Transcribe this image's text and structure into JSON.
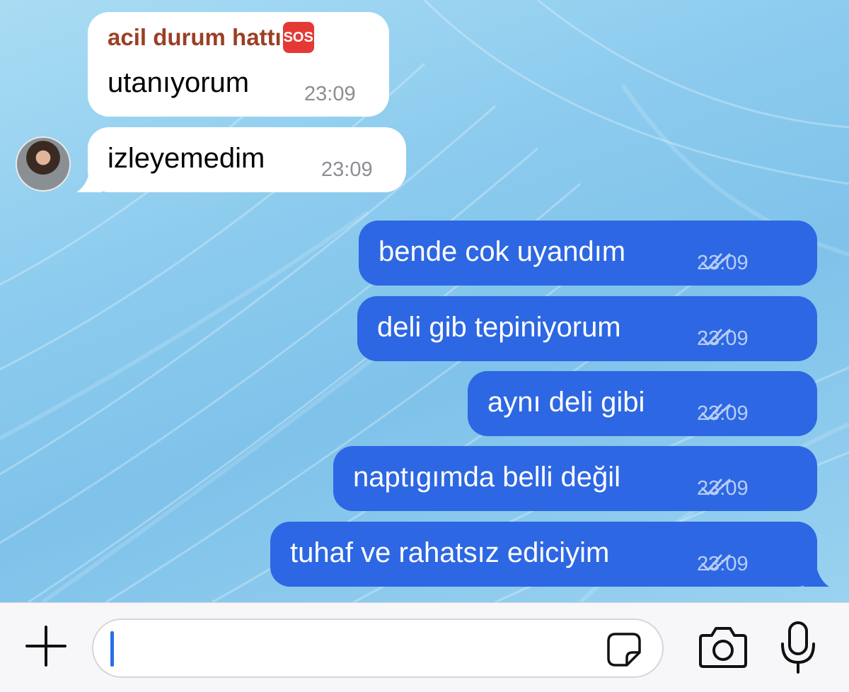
{
  "chat": {
    "incoming": [
      {
        "sender": "acil durum hattı",
        "sender_badge": "SOS",
        "text": "utanıyorum",
        "time": "23:09"
      },
      {
        "text": "izleyemedim",
        "time": "23:09"
      }
    ],
    "outgoing": [
      {
        "text": "bende cok uyandım",
        "time": "23:09"
      },
      {
        "text": "deli gib tepiniyorum",
        "time": "23:09"
      },
      {
        "text": "aynı deli gibi",
        "time": "23:09"
      },
      {
        "text": "naptıgımda belli değil",
        "time": "23:09"
      },
      {
        "text": "tuhaf ve rahatsız ediciyim",
        "time": "23:09"
      }
    ]
  },
  "input_bar": {
    "message_value": "",
    "icons": [
      "plus-icon",
      "sticker-icon",
      "camera-icon",
      "microphone-icon"
    ]
  },
  "colors": {
    "outgoing_bubble": "#2d67e3",
    "incoming_bubble": "#ffffff",
    "sender_name": "#9b3f24",
    "timestamp_in": "#8d8d93",
    "timestamp_out": "#b7cdf6",
    "caret": "#2a6ee8"
  }
}
